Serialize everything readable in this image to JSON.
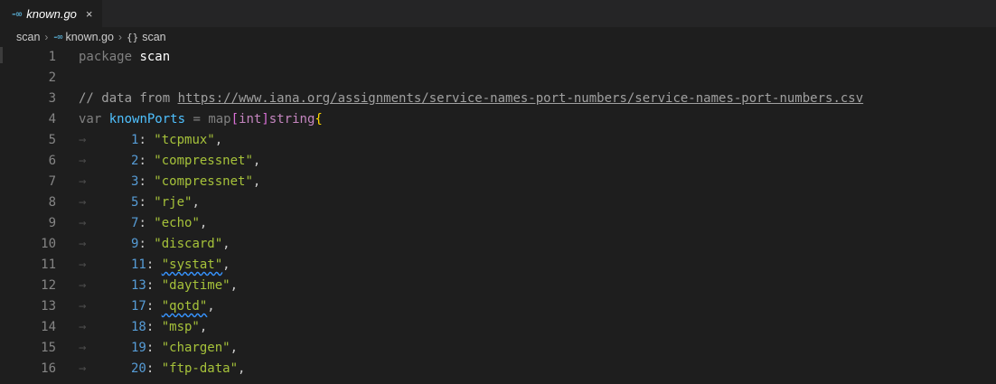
{
  "tab": {
    "label": "known.go",
    "icon": "go-file-icon",
    "close_glyph": "×"
  },
  "breadcrumb": {
    "folder": "scan",
    "file": "known.go",
    "symbol": "scan"
  },
  "code": {
    "line1": {
      "num": "1",
      "kw": "package",
      "name": "scan"
    },
    "line2": {
      "num": "2"
    },
    "line3": {
      "num": "3",
      "prefix": "// data from ",
      "url": "https://www.iana.org/assignments/service-names-port-numbers/service-names-port-numbers.csv"
    },
    "line4": {
      "num": "4",
      "var": "var",
      "ident": "knownPorts",
      "eq": " = ",
      "map": "map",
      "lb": "[",
      "int": "int",
      "rb": "]",
      "string": "string",
      "brace": "{"
    },
    "entries": [
      {
        "num": "5",
        "port": "1",
        "name": "\"tcpmux\""
      },
      {
        "num": "6",
        "port": "2",
        "name": "\"compressnet\""
      },
      {
        "num": "7",
        "port": "3",
        "name": "\"compressnet\""
      },
      {
        "num": "8",
        "port": "5",
        "name": "\"rje\""
      },
      {
        "num": "9",
        "port": "7",
        "name": "\"echo\""
      },
      {
        "num": "10",
        "port": "9",
        "name": "\"discard\""
      },
      {
        "num": "11",
        "port": "11",
        "name": "\"systat\""
      },
      {
        "num": "12",
        "port": "13",
        "name": "\"daytime\""
      },
      {
        "num": "13",
        "port": "17",
        "name": "\"qotd\""
      },
      {
        "num": "14",
        "port": "18",
        "name": "\"msp\""
      },
      {
        "num": "15",
        "port": "19",
        "name": "\"chargen\""
      },
      {
        "num": "16",
        "port": "20",
        "name": "\"ftp-data\""
      }
    ]
  },
  "colors": {
    "keyword_muted": "#808080",
    "number": "#569cd6",
    "string": "#a6c23a",
    "identifier": "#4fc1ff",
    "type": "#c586c0",
    "bracket_gold": "#ffd700",
    "bracket_purple": "#da70d6"
  }
}
